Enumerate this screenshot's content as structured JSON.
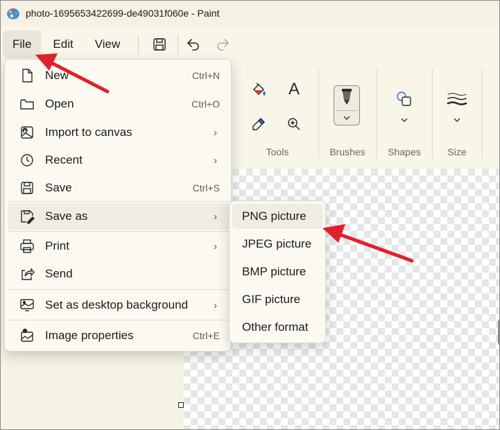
{
  "window": {
    "title": "photo-1695653422699-de49031f060e - Paint",
    "app_icon": "paint-palette-icon"
  },
  "menubar": {
    "items": [
      {
        "label": "File",
        "active": true
      },
      {
        "label": "Edit"
      },
      {
        "label": "View"
      }
    ],
    "quick_actions": [
      "save-icon",
      "undo-icon",
      "redo-icon"
    ]
  },
  "ribbon": {
    "groups": [
      {
        "label": "Tools",
        "icons": [
          "fill-bucket-icon",
          "text-icon",
          "color-picker-icon",
          "magnifier-icon"
        ]
      },
      {
        "label": "Brushes",
        "icons": [
          "brush-icon",
          "chevron-down-icon"
        ]
      },
      {
        "label": "Shapes",
        "icons": [
          "shapes-icon",
          "chevron-down-icon"
        ]
      },
      {
        "label": "Size",
        "icons": [
          "line-size-icon",
          "chevron-down-icon"
        ]
      }
    ]
  },
  "file_menu": {
    "items": [
      {
        "label": "New",
        "shortcut": "Ctrl+N",
        "icon": "new-file-icon"
      },
      {
        "label": "Open",
        "shortcut": "Ctrl+O",
        "icon": "folder-icon"
      },
      {
        "label": "Import to canvas",
        "submenu": true,
        "icon": "import-icon"
      },
      {
        "label": "Recent",
        "submenu": true,
        "icon": "clock-icon"
      },
      {
        "label": "Save",
        "shortcut": "Ctrl+S",
        "icon": "save-icon"
      },
      {
        "label": "Save as",
        "submenu": true,
        "icon": "save-as-icon",
        "highlighted": true
      },
      {
        "label": "Print",
        "submenu": true,
        "icon": "printer-icon"
      },
      {
        "label": "Send",
        "icon": "share-icon"
      },
      {
        "label": "Set as desktop background",
        "submenu": true,
        "icon": "desktop-background-icon"
      },
      {
        "label": "Image properties",
        "shortcut": "Ctrl+E",
        "icon": "image-properties-icon"
      }
    ]
  },
  "save_as_submenu": {
    "items": [
      {
        "label": "PNG picture",
        "highlighted": true
      },
      {
        "label": "JPEG picture"
      },
      {
        "label": "BMP picture"
      },
      {
        "label": "GIF picture"
      },
      {
        "label": "Other format"
      }
    ]
  },
  "colors": {
    "annotation_arrow": "#e0202a",
    "menu_background": "#fbf9f2",
    "hover_background": "#efece4",
    "app_background": "#f7f3e4"
  }
}
